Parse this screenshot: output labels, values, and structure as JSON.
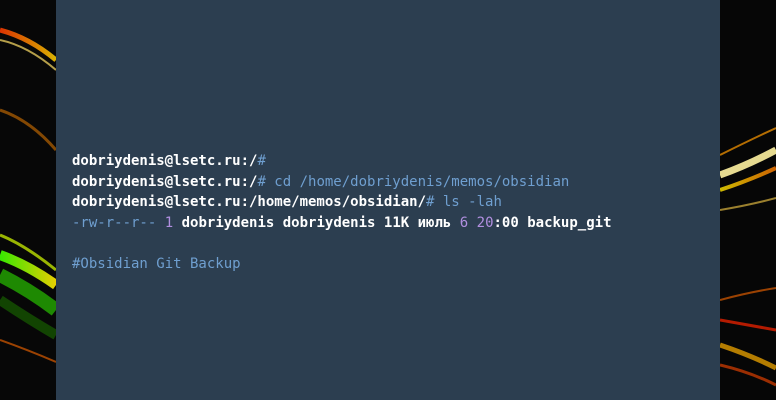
{
  "terminal": {
    "lines": [
      {
        "prompt": "dobriydenis@lsetc.ru:/",
        "symbol": "#",
        "command": ""
      },
      {
        "prompt": "dobriydenis@lsetc.ru:/",
        "symbol": "#",
        "command": " cd /home/dobriydenis/memos/obsidian"
      },
      {
        "prompt": "dobriydenis@lsetc.ru:/home/memos/obsidian/",
        "symbol": "#",
        "command": " ls -lah"
      }
    ],
    "listing": {
      "permissions": "-rw-r--r--",
      "links": "1",
      "owner_group": "dobriydenis dobriydenis 11K июль",
      "day": "6",
      "hour": "20",
      "rest": ":00 backup_git"
    },
    "comment": "#Obsidian Git Backup"
  },
  "colors": {
    "terminal_background": "#2c3e50",
    "prompt_text": "#ffffff",
    "accent_blue": "#6f9fd0",
    "accent_purple": "#b18fe0"
  }
}
